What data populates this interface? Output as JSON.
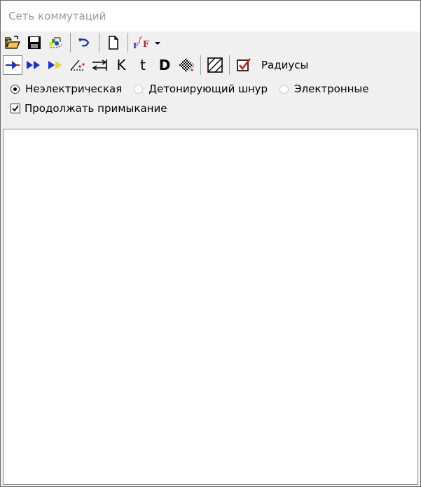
{
  "window": {
    "title": "Сеть коммутаций"
  },
  "toolbar": {
    "row1": [
      {
        "icon": "open-folder-icon"
      },
      {
        "icon": "save-icon"
      },
      {
        "icon": "scatter-icon"
      },
      {
        "icon": "undo-icon"
      },
      {
        "icon": "new-document-icon"
      },
      {
        "icon": "font-format-icon"
      }
    ],
    "row2": [
      {
        "icon": "blue-arrow-icon",
        "active": true
      },
      {
        "icon": "double-blue-arrow-icon"
      },
      {
        "icon": "blue-yellow-arrow-icon"
      },
      {
        "icon": "angle-icon"
      },
      {
        "icon": "swap-arrows-icon"
      },
      {
        "label": "K"
      },
      {
        "label": "t"
      },
      {
        "label": "D"
      },
      {
        "icon": "checker-icon"
      },
      {
        "icon": "hatch-icon"
      },
      {
        "icon": "checkbox-red-icon"
      }
    ],
    "radius_label": "Радиусы"
  },
  "options": {
    "radios": [
      {
        "label": "Неэлектрическая",
        "checked": true
      },
      {
        "label": "Детонирующий шнур",
        "checked": false
      },
      {
        "label": "Электронные",
        "checked": false
      }
    ],
    "continue_label": "Продолжать примыкание",
    "continue_checked": true
  }
}
